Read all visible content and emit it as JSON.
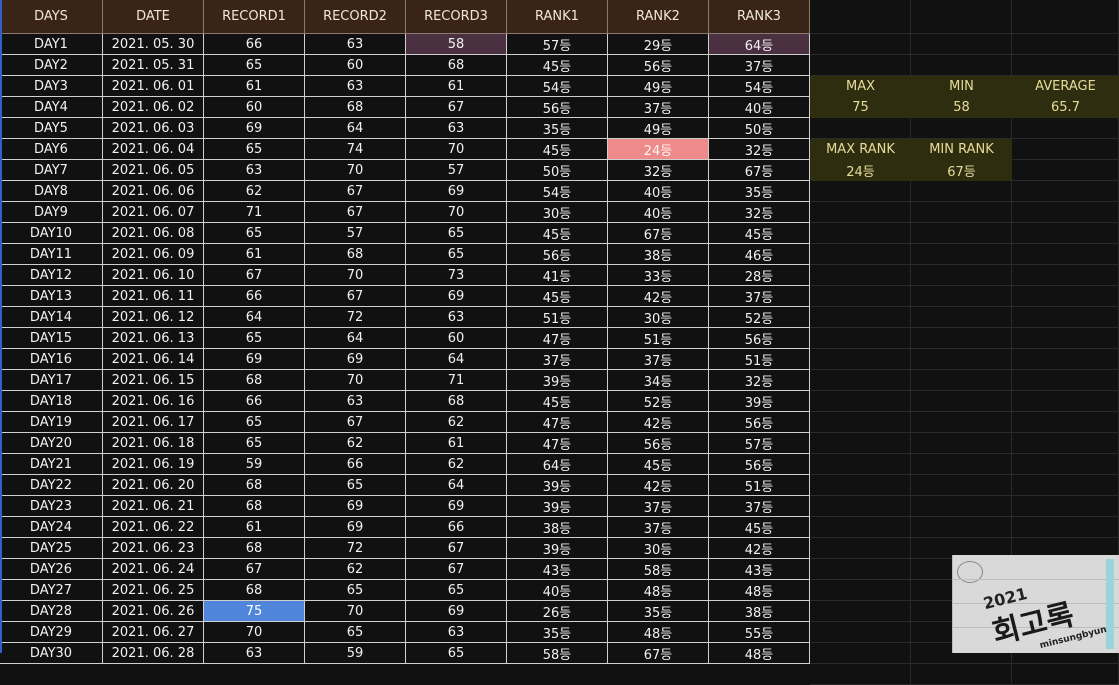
{
  "sheet": {
    "headers": [
      "DAYS",
      "DATE",
      "RECORD1",
      "RECORD2",
      "RECORD3",
      "RANK1",
      "RANK2",
      "RANK3"
    ],
    "rows": [
      [
        "DAY1",
        "2021. 05. 30",
        "66",
        "63",
        "58",
        "57등",
        "29등",
        "64등"
      ],
      [
        "DAY2",
        "2021. 05. 31",
        "65",
        "60",
        "68",
        "45등",
        "56등",
        "37등"
      ],
      [
        "DAY3",
        "2021. 06. 01",
        "61",
        "63",
        "61",
        "54등",
        "49등",
        "54등"
      ],
      [
        "DAY4",
        "2021. 06. 02",
        "60",
        "68",
        "67",
        "56등",
        "37등",
        "40등"
      ],
      [
        "DAY5",
        "2021. 06. 03",
        "69",
        "64",
        "63",
        "35등",
        "49등",
        "50등"
      ],
      [
        "DAY6",
        "2021. 06. 04",
        "65",
        "74",
        "70",
        "45등",
        "24등",
        "32등"
      ],
      [
        "DAY7",
        "2021. 06. 05",
        "63",
        "70",
        "57",
        "50등",
        "32등",
        "67등"
      ],
      [
        "DAY8",
        "2021. 06. 06",
        "62",
        "67",
        "69",
        "54등",
        "40등",
        "35등"
      ],
      [
        "DAY9",
        "2021. 06. 07",
        "71",
        "67",
        "70",
        "30등",
        "40등",
        "32등"
      ],
      [
        "DAY10",
        "2021. 06. 08",
        "65",
        "57",
        "65",
        "45등",
        "67등",
        "45등"
      ],
      [
        "DAY11",
        "2021. 06. 09",
        "61",
        "68",
        "65",
        "56등",
        "38등",
        "46등"
      ],
      [
        "DAY12",
        "2021. 06. 10",
        "67",
        "70",
        "73",
        "41등",
        "33등",
        "28등"
      ],
      [
        "DAY13",
        "2021. 06. 11",
        "66",
        "67",
        "69",
        "45등",
        "42등",
        "37등"
      ],
      [
        "DAY14",
        "2021. 06. 12",
        "64",
        "72",
        "63",
        "51등",
        "30등",
        "52등"
      ],
      [
        "DAY15",
        "2021. 06. 13",
        "65",
        "64",
        "60",
        "47등",
        "51등",
        "56등"
      ],
      [
        "DAY16",
        "2021. 06. 14",
        "69",
        "69",
        "64",
        "37등",
        "37등",
        "51등"
      ],
      [
        "DAY17",
        "2021. 06. 15",
        "68",
        "70",
        "71",
        "39등",
        "34등",
        "32등"
      ],
      [
        "DAY18",
        "2021. 06. 16",
        "66",
        "63",
        "68",
        "45등",
        "52등",
        "39등"
      ],
      [
        "DAY19",
        "2021. 06. 17",
        "65",
        "67",
        "62",
        "47등",
        "42등",
        "56등"
      ],
      [
        "DAY20",
        "2021. 06. 18",
        "65",
        "62",
        "61",
        "47등",
        "56등",
        "57등"
      ],
      [
        "DAY21",
        "2021. 06. 19",
        "59",
        "66",
        "62",
        "64등",
        "45등",
        "56등"
      ],
      [
        "DAY22",
        "2021. 06. 20",
        "68",
        "65",
        "64",
        "39등",
        "42등",
        "51등"
      ],
      [
        "DAY23",
        "2021. 06. 21",
        "68",
        "69",
        "69",
        "39등",
        "37등",
        "37등"
      ],
      [
        "DAY24",
        "2021. 06. 22",
        "61",
        "69",
        "66",
        "38등",
        "37등",
        "45등"
      ],
      [
        "DAY25",
        "2021. 06. 23",
        "68",
        "72",
        "67",
        "39등",
        "30등",
        "42등"
      ],
      [
        "DAY26",
        "2021. 06. 24",
        "67",
        "62",
        "67",
        "43등",
        "58등",
        "43등"
      ],
      [
        "DAY27",
        "2021. 06. 25",
        "68",
        "65",
        "65",
        "40등",
        "48등",
        "48등"
      ],
      [
        "DAY28",
        "2021. 06. 26",
        "75",
        "70",
        "69",
        "26등",
        "35등",
        "38등"
      ],
      [
        "DAY29",
        "2021. 06. 27",
        "70",
        "65",
        "63",
        "35등",
        "48등",
        "55등"
      ],
      [
        "DAY30",
        "2021. 06. 28",
        "63",
        "59",
        "65",
        "58등",
        "67등",
        "48등"
      ]
    ],
    "highlights": {
      "dark": [
        [
          0,
          4
        ],
        [
          0,
          7
        ]
      ],
      "pink": [
        [
          5,
          6
        ]
      ],
      "blue": [
        [
          27,
          2
        ]
      ]
    }
  },
  "stats": {
    "max_label": "MAX",
    "max_value": "75",
    "min_label": "MIN",
    "min_value": "58",
    "avg_label": "AVERAGE",
    "avg_value": "65.7",
    "max_rank_label": "MAX RANK",
    "max_rank_value": "24등",
    "min_rank_label": "MIN RANK",
    "min_rank_value": "67등"
  },
  "sticker": {
    "year": "2021",
    "title": "회고록",
    "subtitle": "minsungbyun"
  },
  "colors": {
    "header_bg": "#3a2418",
    "stat_bg": "#2f2d10",
    "highlight_dark": "#4a3040",
    "highlight_pink": "#ef8a8a",
    "highlight_blue": "#4f86dc"
  }
}
